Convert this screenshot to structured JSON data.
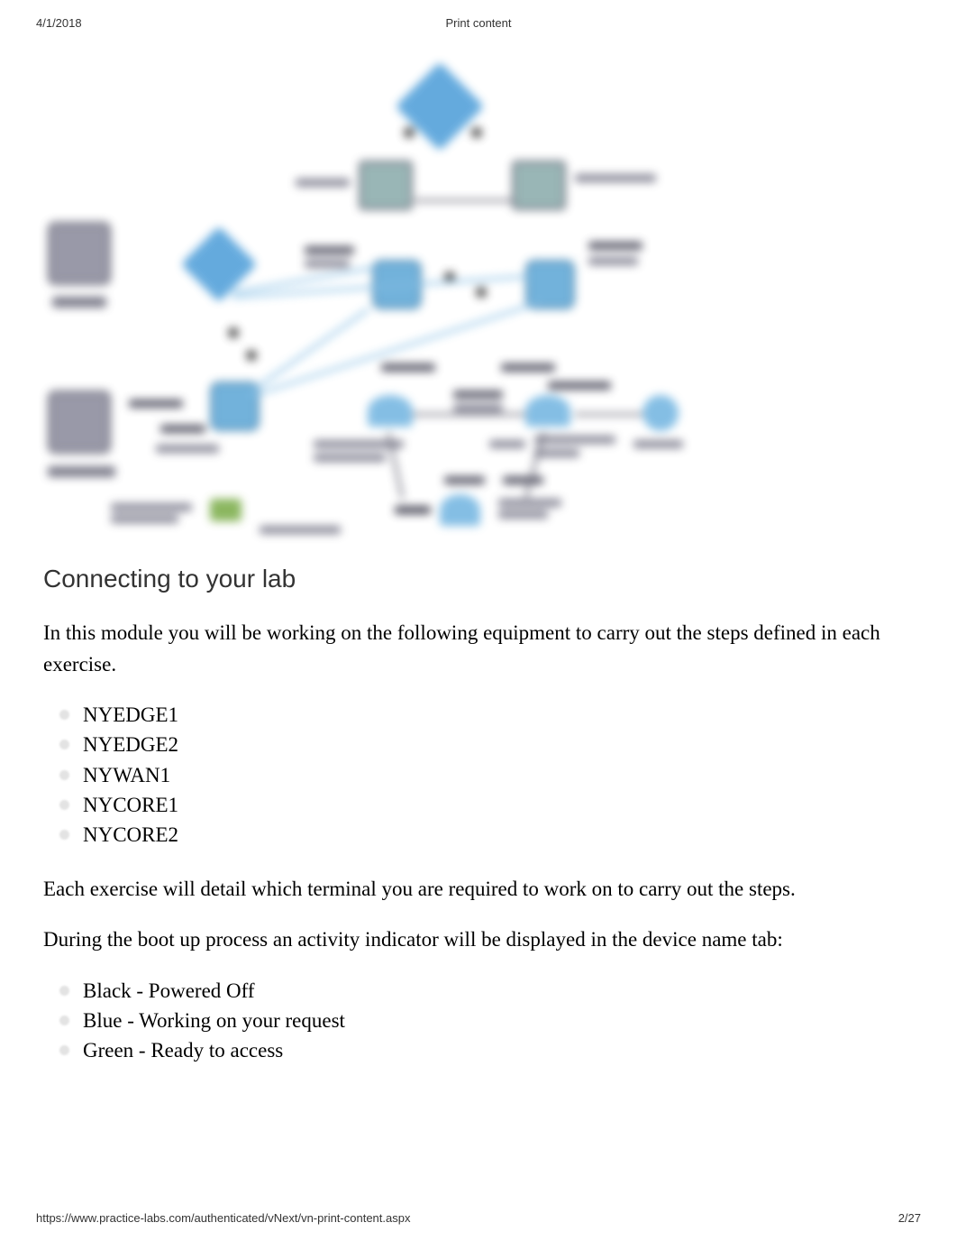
{
  "header": {
    "date": "4/1/2018",
    "title": "Print content"
  },
  "section": {
    "heading": "Connecting to your lab",
    "intro": "In this module you will be working on the following equipment to carry out the steps defined in each exercise.",
    "equipment": [
      "NYEDGE1",
      "NYEDGE2",
      "NYWAN1",
      "NYCORE1",
      "NYCORE2"
    ],
    "para2": "Each exercise will detail which terminal you are required to work on to carry out the steps.",
    "para3": "During the boot up process an activity indicator will be displayed in the device name tab:",
    "indicators": [
      "Black - Powered Off",
      "Blue - Working on your request",
      "Green - Ready to access"
    ]
  },
  "footer": {
    "url": "https://www.practice-labs.com/authenticated/vNext/vn-print-content.aspx",
    "page": "2/27"
  }
}
